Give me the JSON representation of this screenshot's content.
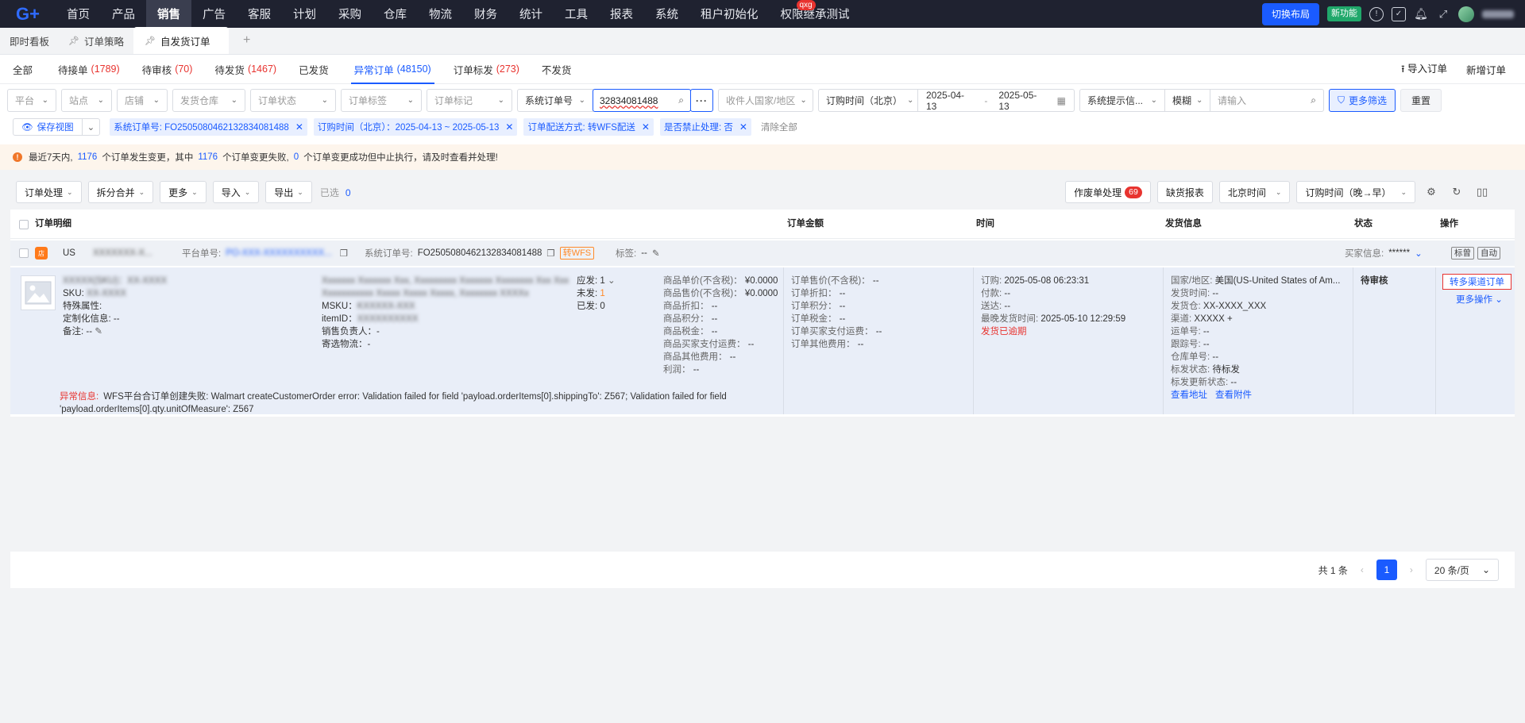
{
  "topnav": {
    "logo": "G+",
    "items": [
      "首页",
      "产品",
      "销售",
      "广告",
      "客服",
      "计划",
      "采购",
      "仓库",
      "物流",
      "财务",
      "统计",
      "工具",
      "报表",
      "系统",
      "租户初始化",
      "权限继承测试"
    ],
    "active_index": 2,
    "badge": "qxg",
    "switch_layout": "切换布局",
    "new_feature": "新功能",
    "icons": [
      "info-icon",
      "task-icon",
      "bell-icon",
      "fullscreen-icon",
      "avatar"
    ]
  },
  "page_tabs": [
    {
      "label": "即时看板"
    },
    {
      "label": "订单策略"
    },
    {
      "label": "自发货订单"
    }
  ],
  "page_tabs_add": "+",
  "status_tabs": [
    {
      "label": "全部",
      "count": ""
    },
    {
      "label": "待接单",
      "count": "(1789)"
    },
    {
      "label": "待审核",
      "count": "(70)"
    },
    {
      "label": "待发货",
      "count": "(1467)"
    },
    {
      "label": "已发货",
      "count": ""
    },
    {
      "label": "异常订单",
      "count": "(48150)"
    },
    {
      "label": "订单标发",
      "count": "(273)"
    },
    {
      "label": "不发货",
      "count": ""
    }
  ],
  "status_right": {
    "import": "导入订单",
    "add": "新增订单"
  },
  "filters": {
    "platform": "平台",
    "site": "站点",
    "shop": "店铺",
    "warehouse": "发货仓库",
    "order_status": "订单状态",
    "order_tag": "订单标签",
    "order_mark": "订单标记",
    "search_field": "系统订单号",
    "search_value": "32834081488",
    "recipient_country": "收件人国家/地区",
    "time_field": "订购时间（北京）",
    "date_start": "2025-04-13",
    "date_sep": "-",
    "date_end": "2025-05-13",
    "system_tip": "系统提示信...",
    "match_mode": "模糊",
    "keyword_placeholder": "请输入",
    "more_filter": "更多筛选",
    "reset": "重置"
  },
  "saved_view": "保存视图",
  "chips": [
    "系统订单号: FO250508046213283408148​8",
    "订购时间（北京）：2025-04-13 ~ 2025-05-13",
    "订单配送方式: 转WFS配送",
    "是否禁止处理: 否"
  ],
  "clear_all": "清除全部",
  "alert": {
    "p1": "最近7天内,",
    "n1": "1176",
    "p2": "个订单发生变更，其中",
    "n2": "1176",
    "p3": "个订单变更失败,",
    "n3": "0",
    "p4": "个订单变更成功但中止执行，请及时查看并处理!"
  },
  "toolbar": {
    "buttons": [
      "订单处理",
      "拆分合并",
      "更多",
      "导入",
      "导出"
    ],
    "selected_label": "已选",
    "selected_count": "0",
    "voided_label": "作废单处理",
    "voided_count": "69",
    "shortage_report": "缺货报表",
    "timezone": "北京时间",
    "sort": "订购时间（晚→早）"
  },
  "table_header": {
    "detail": "订单明细",
    "amount": "订单金额",
    "time": "时间",
    "shipping": "发货信息",
    "status": "状态",
    "ops": "操作"
  },
  "order": {
    "site": "US",
    "shop_blurred": "XXXXXXX-X...",
    "platform_no_label": "平台单号:",
    "platform_no": "PO-XXX-XXXXXXXXXX...",
    "sys_no_label": "系统订单号:",
    "sys_no": "FO2505080462132834081488",
    "wfs_tag": "转WFS",
    "tag_label": "标签:",
    "tag_value": "--",
    "buyer_label": "买家信息:",
    "buyer_value": "******",
    "btn_mark": "标曾",
    "btn_auto": "自动",
    "product": {
      "name_label": "XXXXX(SKU)：XX-XXXX",
      "sku_label": "SKU:",
      "sku": "XX-XXXX",
      "special_attr": "特殊属性:",
      "custom_info": "定制化信息:",
      "custom_value": "--",
      "remark": "备注:",
      "remark_value": "--",
      "title_l1": "Xxxxxxx Xxxxxxx Xxx, Xxxxxxxxx Xxxxxxx Xxxxxxxx Xxx Xxx",
      "title_l2": "Xxxxxxxxxxx Xxxxx Xxxxx Xxxxx, Xxxxxxxx XXXXx",
      "msku_label": "MSKU：",
      "msku": "KXXXXX-XXX",
      "itemid_label": "itemID：",
      "itemid": "XXXXXXXXXX",
      "sales_owner": "销售负责人：",
      "sales_owner_value": "-",
      "ship_logistics": "寄选物流：",
      "ship_logistics_value": "-",
      "qty_due": "应发:",
      "qty_due_value": "1",
      "qty_pending": "未发:",
      "qty_pending_value": "1",
      "qty_shipped": "已发:",
      "qty_shipped_value": "0",
      "prices": [
        [
          "商品单价(不含税)：",
          "¥0.0000"
        ],
        [
          "商品售价(不含税)：",
          "¥0.0000"
        ],
        [
          "商品折扣：",
          "--"
        ],
        [
          "商品积分：",
          "--"
        ],
        [
          "商品税金：",
          "--"
        ],
        [
          "商品买家支付运费：",
          "--"
        ],
        [
          "商品其他费用：",
          "--"
        ],
        [
          "利润：",
          "--"
        ]
      ]
    },
    "amounts": [
      [
        "订单售价(不含税)：",
        "--"
      ],
      [
        "订单折扣：",
        "--"
      ],
      [
        "订单积分：",
        "--"
      ],
      [
        "订单税金：",
        "--"
      ],
      [
        "订单买家支付运费：",
        "--"
      ],
      [
        "订单其他费用：",
        "--"
      ]
    ],
    "times": [
      [
        "订购:",
        "2025-05-08 06:23:31"
      ],
      [
        "付款:",
        "--"
      ],
      [
        "送达:",
        "--"
      ],
      [
        "最晚发货时间:",
        "2025-05-10 12:29:59"
      ]
    ],
    "overdue": "发货已逾期",
    "shipping": [
      [
        "国家/地区:",
        "美国(US-United States of Am..."
      ],
      [
        "发货时间:",
        "--"
      ],
      [
        "发货仓:",
        "XX-XXXX_XXX"
      ],
      [
        "渠道:",
        "XXXXX  +"
      ],
      [
        "运单号:",
        "--"
      ],
      [
        "跟踪号:",
        "--"
      ],
      [
        "仓库单号:",
        "--"
      ],
      [
        "标发状态:",
        "待标发"
      ],
      [
        "标发更新状态:",
        "--"
      ]
    ],
    "view_address": "查看地址",
    "view_attach": "查看附件",
    "status": "待审核",
    "op_primary": "转多渠道订单",
    "op_more": "更多操作",
    "error_label": "异常信息:",
    "error_text": "WFS平台合订单创建失败: Walmart createCustomerOrder error: Validation failed for field 'payload.orderItems[0].shippingTo': Z567; Validation failed for field 'payload.orderItems[0].qty.unitOfMeasure': Z567"
  },
  "pager": {
    "total": "共 1 条",
    "page": "1",
    "size": "20 条/页"
  },
  "colors": {
    "primary": "#1a5bff",
    "danger": "#e8332f",
    "nav_bg": "#1f2230"
  }
}
